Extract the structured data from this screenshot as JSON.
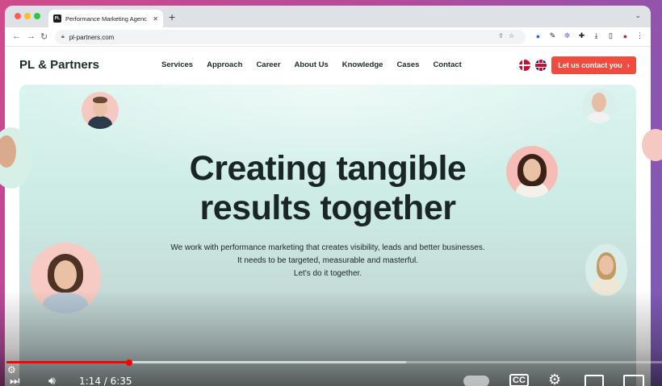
{
  "browser": {
    "tab_title": "Performance Marketing Agenc",
    "tab_favicon": "PL",
    "url": "pl-partners.com"
  },
  "site": {
    "brand": "PL & Partners",
    "nav": [
      "Services",
      "Approach",
      "Career",
      "About Us",
      "Knowledge",
      "Cases",
      "Contact"
    ],
    "cta_label": "Let us contact you",
    "cta_icon": "›",
    "accent_color": "#ef4c3f",
    "hero_title_line1": "Creating tangible",
    "hero_title_line2": "results together",
    "hero_sub_line1": "We work with performance marketing that creates visibility, leads and better businesses.",
    "hero_sub_line2": "It needs to be targeted, measurable and masterful.",
    "hero_sub_line3": "Let's do it together."
  },
  "player": {
    "time_display": "1:14 / 6:35",
    "played_fraction": 0.187,
    "buffered_fraction": 0.61
  }
}
